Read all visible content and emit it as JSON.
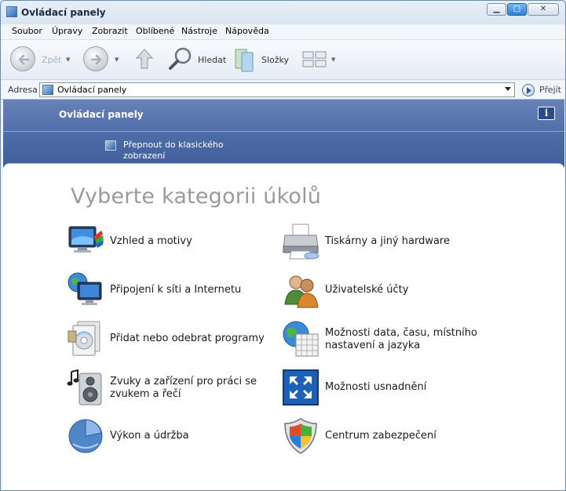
{
  "window": {
    "title": "Ovládací panely"
  },
  "titlebar_buttons": {
    "minimize": "▁",
    "maximize": "□",
    "close": "✕"
  },
  "menu": [
    "Soubor",
    "Úpravy",
    "Zobrazit",
    "Oblíbené",
    "Nástroje",
    "Nápověda"
  ],
  "toolbar": {
    "back_label": "Zpět",
    "search_label": "Hledat",
    "folders_label": "Složky"
  },
  "address": {
    "label": "Adresa",
    "value": "Ovládací panely",
    "go_label": "Přejít"
  },
  "header": {
    "title": "Ovládací panely",
    "info": "i",
    "switch_view": "Přepnout do klasického zobrazení"
  },
  "main": {
    "heading": "Vyberte kategorii úkolů",
    "categories_left": [
      {
        "label": "Vzhled a motivy",
        "icon": "display-appearance-icon"
      },
      {
        "label": "Připojení k síti a Internetu",
        "icon": "network-globe-icon"
      },
      {
        "label": "Přidat nebo odebrat programy",
        "icon": "add-remove-programs-icon"
      },
      {
        "label": "Zvuky a zařízení pro práci se zvukem a řečí",
        "icon": "sound-speaker-icon"
      },
      {
        "label": "Výkon a údržba",
        "icon": "performance-chart-icon"
      }
    ],
    "categories_right": [
      {
        "label": "Tiskárny a jiný hardware",
        "icon": "printer-icon"
      },
      {
        "label": "Uživatelské účty",
        "icon": "user-accounts-icon"
      },
      {
        "label": "Možnosti data, času, místního nastavení a jazyka",
        "icon": "date-time-globe-icon"
      },
      {
        "label": "Možnosti usnadnění",
        "icon": "accessibility-icon"
      },
      {
        "label": "Centrum zabezpečení",
        "icon": "security-shield-icon"
      }
    ]
  }
}
